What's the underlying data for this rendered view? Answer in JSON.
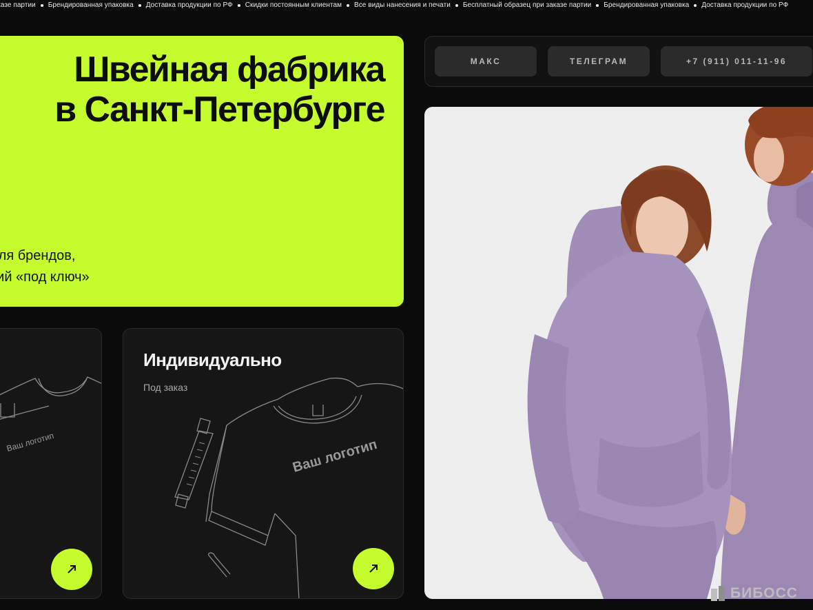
{
  "ticker": {
    "items": [
      "заказе партии",
      "Брендированная упаковка",
      "Доставка продукции по РФ",
      "Скидки постоянным клиентам",
      "Все виды нанесения и печати",
      "Бесплатный образец при заказе партии",
      "Брендированная упаковка",
      "Доставка продукции по РФ"
    ]
  },
  "hero": {
    "title_line1": "Швейная фабрика",
    "title_line2": "в Санкт-Петербурге",
    "subtitle_line1": "для брендов,",
    "subtitle_line2": "тий «под ключ»"
  },
  "contacts": {
    "max": "МАКС",
    "telegram": "ТЕЛЕГРАМ",
    "phone": "+7 (911) 011-11-96"
  },
  "cards": {
    "left": {
      "logo_text": "Ваш логотип"
    },
    "individual": {
      "title": "Индивидуально",
      "subtitle": "Под заказ",
      "logo_text": "Ваш логотип"
    }
  },
  "watermark": "БИБОСС",
  "colors": {
    "accent": "#c5fc2e",
    "background": "#0b0b0b",
    "card": "#161616",
    "hoodie": "#a08db8"
  }
}
